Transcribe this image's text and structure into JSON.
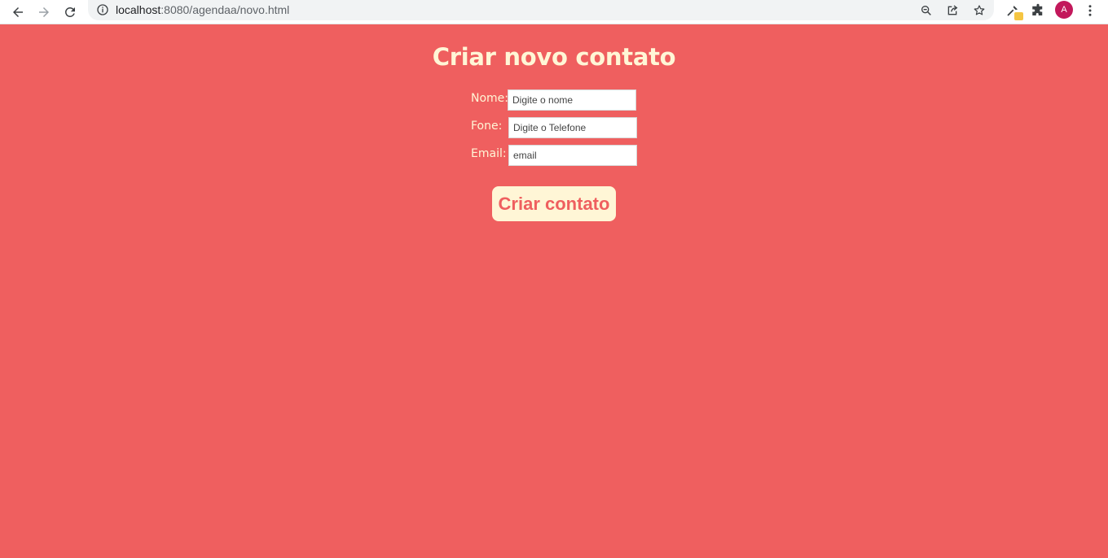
{
  "browser": {
    "url_host": "localhost",
    "url_path": ":8080/agendaa/novo.html",
    "profile_initial": "A",
    "profile_color": "#c2185b",
    "icons": [
      "back-icon",
      "forward-icon",
      "reload-icon",
      "site-info-icon",
      "zoom-icon",
      "share-icon",
      "bookmark-star-icon",
      "extension-eyedropper-icon",
      "extensions-puzzle-icon",
      "menu-kebab-icon"
    ]
  },
  "page": {
    "background_color": "#ef5f5f",
    "accent_color": "#fff6d6",
    "title": "Criar novo contato"
  },
  "form": {
    "fields": [
      {
        "label": "Nome:",
        "placeholder": "Digite o nome"
      },
      {
        "label": "Fone:",
        "placeholder": "Digite o Telefone"
      },
      {
        "label": "Email:",
        "placeholder": "email"
      }
    ],
    "submit_label": "Criar contato"
  }
}
